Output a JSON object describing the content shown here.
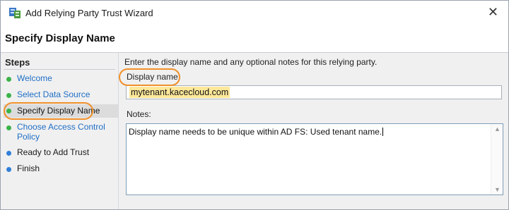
{
  "window": {
    "title": "Add Relying Party Trust Wizard",
    "close_glyph": "✕"
  },
  "header": {
    "title": "Specify Display Name"
  },
  "steps": {
    "title": "Steps",
    "items": [
      {
        "label": "Welcome",
        "state": "done"
      },
      {
        "label": "Select Data Source",
        "state": "done"
      },
      {
        "label": "Specify Display Name",
        "state": "current"
      },
      {
        "label": "Choose Access Control\nPolicy",
        "state": "done"
      },
      {
        "label": "Ready to Add Trust",
        "state": "pending"
      },
      {
        "label": "Finish",
        "state": "pending"
      }
    ]
  },
  "main": {
    "description": "Enter the display name and any optional notes for this relying party.",
    "display_name_label": "Display name:",
    "display_name_value": "mytenant.kacecloud.com",
    "notes_label": "Notes:",
    "notes_value": "Display name needs to be unique within AD FS: Used tenant name."
  },
  "colors": {
    "highlight_ring": "#f0902a",
    "done_dot": "#3bb34a",
    "pending_dot": "#2f7fd8",
    "link": "#1f6ec6",
    "text_highlight": "#fde89a"
  },
  "icons": {
    "app": "adfs-wizard-icon",
    "close": "close-icon"
  }
}
